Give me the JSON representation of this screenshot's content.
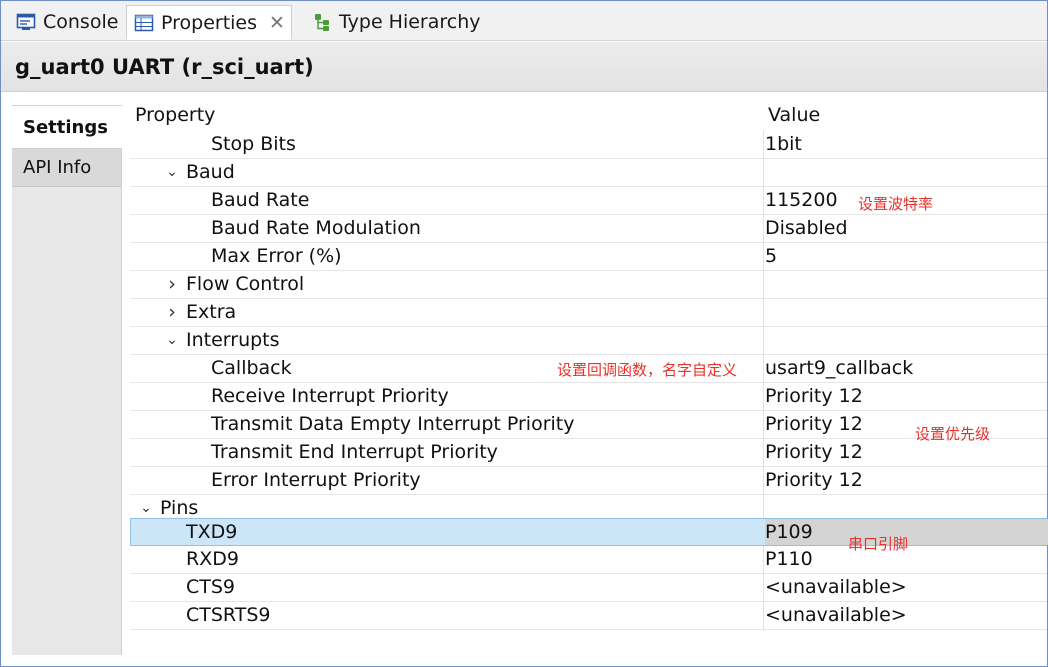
{
  "tabs": [
    {
      "label": "Console",
      "icon": "console-icon"
    },
    {
      "label": "Properties",
      "icon": "properties-icon"
    },
    {
      "label": "Type Hierarchy",
      "icon": "hierarchy-icon"
    }
  ],
  "tab_close": "✕",
  "header": {
    "title": "g_uart0 UART (r_sci_uart)"
  },
  "side_tabs": {
    "settings": "Settings",
    "api_info": "API Info"
  },
  "table": {
    "col_property": "Property",
    "col_value": "Value",
    "rows": [
      {
        "name": "Stop Bits",
        "value": "1bit"
      },
      {
        "name": "Baud",
        "value": "",
        "twisty": "⌄"
      },
      {
        "name": "Baud Rate",
        "value": "115200"
      },
      {
        "name": "Baud Rate Modulation",
        "value": "Disabled"
      },
      {
        "name": "Max Error (%)",
        "value": "5"
      },
      {
        "name": "Flow Control",
        "value": "",
        "twisty": "›"
      },
      {
        "name": "Extra",
        "value": "",
        "twisty": "›"
      },
      {
        "name": "Interrupts",
        "value": "",
        "twisty": "⌄"
      },
      {
        "name": "Callback",
        "value": "usart9_callback"
      },
      {
        "name": "Receive Interrupt Priority",
        "value": "Priority 12"
      },
      {
        "name": "Transmit Data Empty Interrupt Priority",
        "value": "Priority 12"
      },
      {
        "name": "Transmit End Interrupt Priority",
        "value": "Priority 12"
      },
      {
        "name": "Error Interrupt Priority",
        "value": "Priority 12"
      },
      {
        "name": "Pins",
        "value": "",
        "twisty": "⌄"
      },
      {
        "name": "TXD9",
        "value": "P109"
      },
      {
        "name": "RXD9",
        "value": "P110"
      },
      {
        "name": "CTS9",
        "value": "<unavailable>"
      },
      {
        "name": "CTSRTS9",
        "value": "<unavailable>"
      }
    ]
  },
  "annotations": {
    "baud_rate": "设置波特率",
    "callback": "设置回调函数，名字自定义",
    "priority": "设置优先级",
    "pins": "串口引脚"
  },
  "colors": {
    "annotation": "#e8322c",
    "selection": "#cce6f7",
    "frame": "#6e8fc9"
  }
}
